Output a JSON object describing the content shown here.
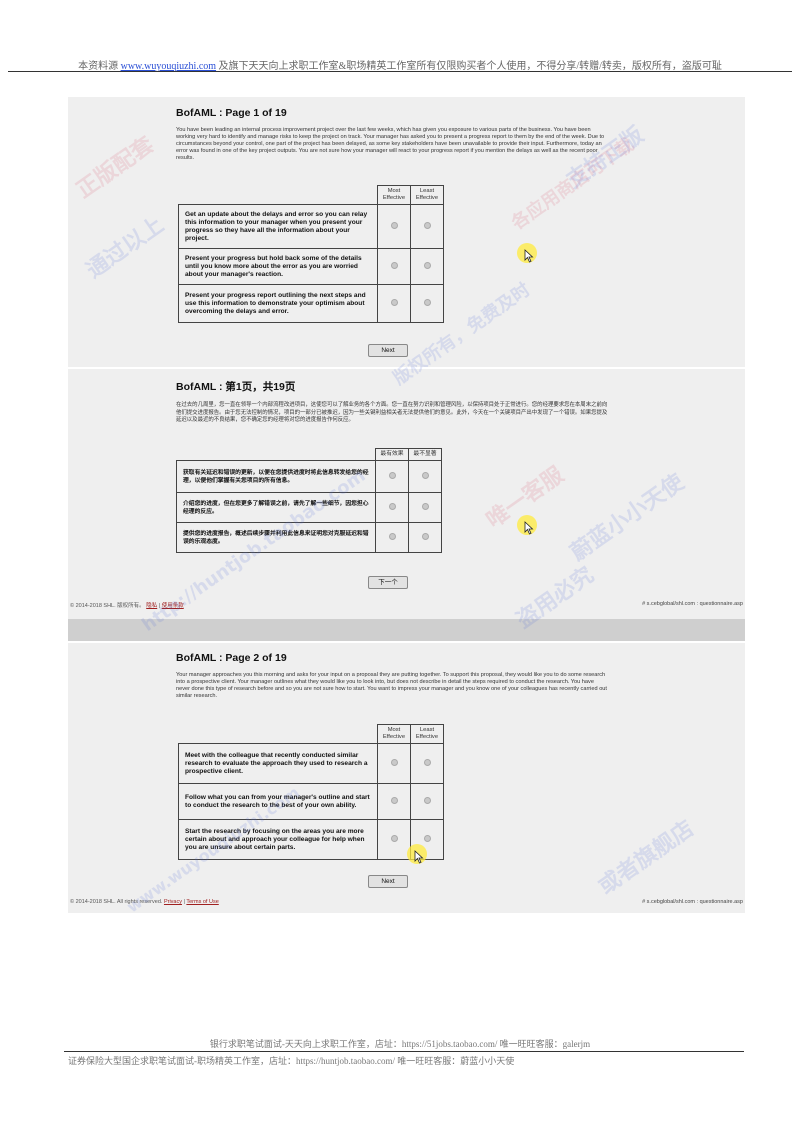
{
  "header": {
    "prefix": "本资料源",
    "link": "www.wuyouqiuzhi.com",
    "suffix": "及旗下天天向上求职工作室&职场精英工作室所有仅限购买者个人使用，不得分享/转赠/转卖，版权所有，盗版可耻"
  },
  "shot1": {
    "title": "BofAML : Page 1 of 19",
    "intro": "You have been leading an internal process improvement project over the last few weeks, which has given you exposure to various parts of the business. You have been working very hard to identify and manage risks to keep the project on track. Your manager has asked you to present a progress report to them by the end of the week. Due to circumstances beyond your control, one part of the project has been delayed, as some key stakeholders have been unavailable to provide their input. Furthermore, today an error was found in one of the key project outputs. You are not sure how your manager will react to your progress report if you mention the delays as well as the recent poor results.",
    "col_most": "Most Effective",
    "col_least": "Least Effective",
    "options": [
      "Get an update about the delays and error so you can relay this information to your manager when you present your progress so they have all the information about your project.",
      "Present your progress but hold back some of the details until you know more about the error as you are worried about your manager's reaction.",
      "Present your progress report outlining the next steps and use this information to demonstrate your optimism about overcoming the delays and error."
    ],
    "next": "Next"
  },
  "shot2": {
    "title": "BofAML : 第1页，共19页",
    "intro": "在过去的几周里，您一直在领导一个内部流程改进项目，这使您可以了解业务的各个方面。您一直在努力识别和管理风险，以保持项目处于正常进行。您的经理要求您在本周末之前向他们提交进度报告。由于您无法控制的情况，项目的一部分已被推迟，因为一些关键利益相关者无法提供他们的意见。此外，今天在一个关键项目产出中发现了一个错误。如果您提及延迟以及最近的不良结果，您不确定您的经理将对您的进度报告作何反应。",
    "col_most": "最有效果",
    "col_least": "最不显著",
    "options": [
      "获取有关延迟和错误的更新，以便在您提供进度时将此信息转发给您的经理，以便他们掌握有关您项目的所有信息。",
      "介绍您的进度，但在您更多了解错误之前，请先了解一些细节，因您担心经理的反应。",
      "提供您的进度报告，概述后续步骤并利用此信息来证明您对克服延迟和错误的乐观态度。"
    ],
    "next": "下一个",
    "footer_left": "© 2014-2018 SHL. 版权所有。",
    "footer_link1": "隐私",
    "footer_link2": "使用条款",
    "footer_right": "# s.cebglobal/shl.com : questionnaire.asp"
  },
  "shot3": {
    "title": "BofAML : Page 2 of 19",
    "intro": "Your manager approaches you this morning and asks for your input on a proposal they are putting together. To support this proposal, they would like you to do some research into a prospective client. Your manager outlines what they would like you to look into, but does not describe in detail the steps required to conduct the research. You have never done this type of research before and so you are not sure how to start. You want to impress your manager and you know one of your colleagues has recently carried out similar research.",
    "col_most": "Most Effective",
    "col_least": "Least Effective",
    "options": [
      "Meet with the colleague that recently conducted similar research to evaluate the approach they used to research a prospective client.",
      "Follow what you can from your manager's outline and start to conduct the research to the best of your own ability.",
      "Start the research by focusing on the areas you are more certain about and approach your colleague for help when you are unsure about certain parts."
    ],
    "next": "Next",
    "footer_left": "© 2014-2018 SHL. All rights reserved.",
    "footer_link1": "Privacy",
    "footer_link2": "Terms of Use",
    "footer_right": "# s.cebglobal/shl.com : questionnaire.asp"
  },
  "watermarks": [
    "正版配套",
    "通过以上",
    "http://huntjob.taobao.com",
    "唯一客服",
    "各应用商店可下载",
    "版权所有，免费及时",
    "盗用必究",
    "支持正版",
    "或者旗舰店",
    "蔚蓝小小天使",
    "www.wuyouqiuzhi.com"
  ],
  "footer": {
    "line1": "银行求职笔试面试-天天向上求职工作室，店址：https://51jobs.taobao.com/  唯一旺旺客服：galerjm",
    "line2": "证券保险大型国企求职笔试面试-职场精英工作室，店址：https://huntjob.taobao.com/  唯一旺旺客服：蔚蓝小小天使"
  }
}
